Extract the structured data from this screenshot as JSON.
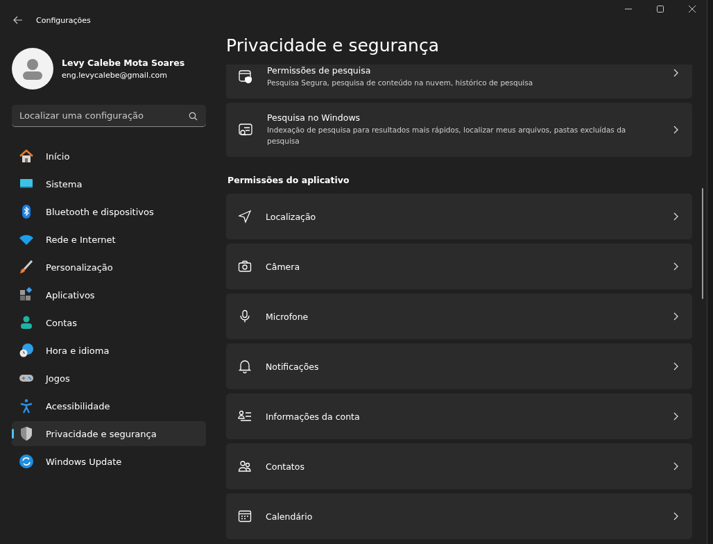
{
  "window": {
    "title": "Configurações"
  },
  "account": {
    "name": "Levy Calebe Mota Soares",
    "email": "eng.levycalebe@gmail.com"
  },
  "search": {
    "placeholder": "Localizar uma configuração"
  },
  "sidebar": {
    "items": [
      {
        "label": "Início",
        "selected": false
      },
      {
        "label": "Sistema",
        "selected": false
      },
      {
        "label": "Bluetooth e dispositivos",
        "selected": false
      },
      {
        "label": "Rede e Internet",
        "selected": false
      },
      {
        "label": "Personalização",
        "selected": false
      },
      {
        "label": "Aplicativos",
        "selected": false
      },
      {
        "label": "Contas",
        "selected": false
      },
      {
        "label": "Hora e idioma",
        "selected": false
      },
      {
        "label": "Jogos",
        "selected": false
      },
      {
        "label": "Acessibilidade",
        "selected": false
      },
      {
        "label": "Privacidade e segurança",
        "selected": true
      },
      {
        "label": "Windows Update",
        "selected": false
      }
    ]
  },
  "page": {
    "title": "Privacidade e segurança"
  },
  "search_cards": [
    {
      "title": "Permissões de pesquisa",
      "description": "Pesquisa Segura, pesquisa de conteúdo na nuvem, histórico de pesquisa"
    },
    {
      "title": "Pesquisa no Windows",
      "description": "Indexação de pesquisa para resultados mais rápidos, localizar meus arquivos, pastas excluídas da pesquisa"
    }
  ],
  "section": {
    "title": "Permissões do aplicativo"
  },
  "permissions": [
    {
      "label": "Localização"
    },
    {
      "label": "Câmera"
    },
    {
      "label": "Microfone"
    },
    {
      "label": "Notificações"
    },
    {
      "label": "Informações da conta"
    },
    {
      "label": "Contatos"
    },
    {
      "label": "Calendário"
    }
  ]
}
